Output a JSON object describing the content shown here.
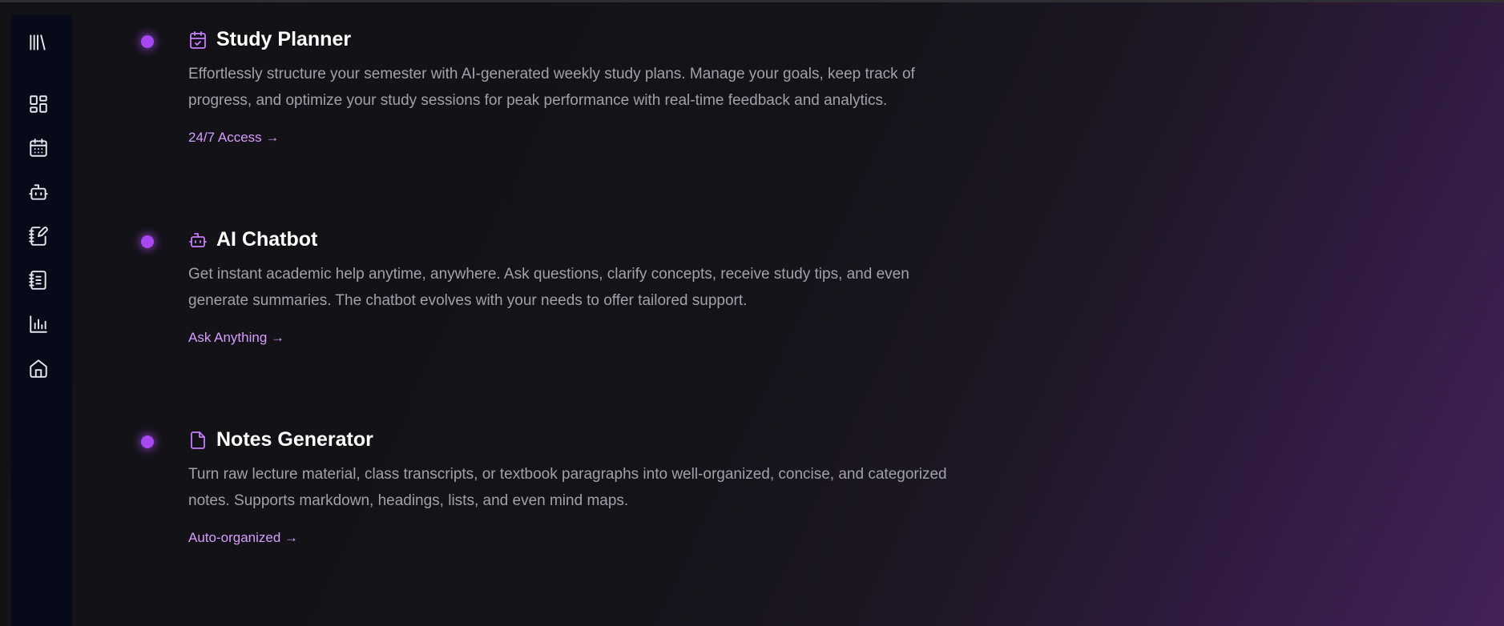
{
  "sidebar": {
    "logo_icon": "library-icon",
    "items": [
      {
        "icon": "dashboard-icon",
        "name": "dashboard"
      },
      {
        "icon": "calendar-icon",
        "name": "planner"
      },
      {
        "icon": "bot-icon",
        "name": "chatbot"
      },
      {
        "icon": "notebook-pen-icon",
        "name": "notes"
      },
      {
        "icon": "notebook-text-icon",
        "name": "summaries"
      },
      {
        "icon": "bar-chart-icon",
        "name": "analytics"
      },
      {
        "icon": "home-icon",
        "name": "home"
      }
    ]
  },
  "features": [
    {
      "icon": "calendar-check-icon",
      "title": "Study Planner",
      "description": "Effortlessly structure your semester with AI-generated weekly study plans. Manage your goals, keep track of progress, and optimize your study sessions for peak performance with real-time feedback and analytics.",
      "link": "24/7 Access →"
    },
    {
      "icon": "bot-icon",
      "title": "AI Chatbot",
      "description": "Get instant academic help anytime, anywhere. Ask questions, clarify concepts, receive study tips, and even generate summaries. The chatbot evolves with your needs to offer tailored support.",
      "link": "Ask Anything →"
    },
    {
      "icon": "file-icon",
      "title": "Notes Generator",
      "description": "Turn raw lecture material, class transcripts, or textbook paragraphs into well-organized, concise, and categorized notes. Supports markdown, headings, lists, and even mind maps.",
      "link": "Auto-organized →"
    }
  ],
  "colors": {
    "accent": "#a748f0",
    "link": "#d79cff",
    "text_muted": "#a1a1aa",
    "sidebar_bg": "#070a18"
  }
}
